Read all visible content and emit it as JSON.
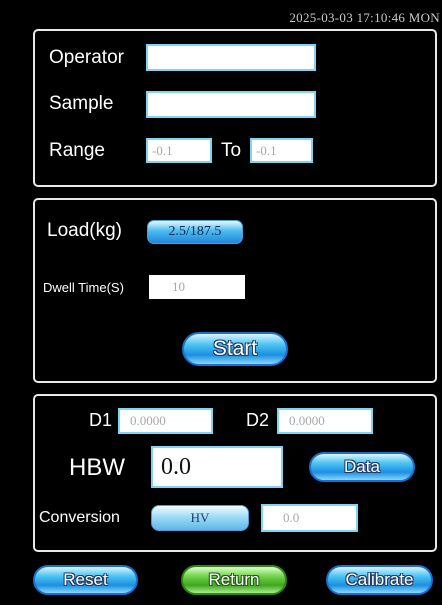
{
  "status": {
    "datetime": "2025-03-03 17:10:46 MON"
  },
  "operator_panel": {
    "operator_label": "Operator",
    "operator_value": "",
    "sample_label": "Sample",
    "sample_value": "",
    "range_label": "Range",
    "range_from": "-0.1",
    "to_label": "To",
    "range_to": "-0.1"
  },
  "test_panel": {
    "load_label": "Load(kg)",
    "load_value": "2.5/187.5",
    "dwell_label": "Dwell Time(S)",
    "dwell_value": "10",
    "start_label": "Start"
  },
  "result_panel": {
    "d1_label": "D1",
    "d1_value": "0.0000",
    "d2_label": "D2",
    "d2_value": "0.0000",
    "hbw_label": "HBW",
    "hbw_value": "0.0",
    "data_label": "Data",
    "conversion_label": "Conversion",
    "conversion_type": "HV",
    "conversion_value": "0.0"
  },
  "footer": {
    "reset_label": "Reset",
    "return_label": "Return",
    "calibrate_label": "Calibrate"
  }
}
